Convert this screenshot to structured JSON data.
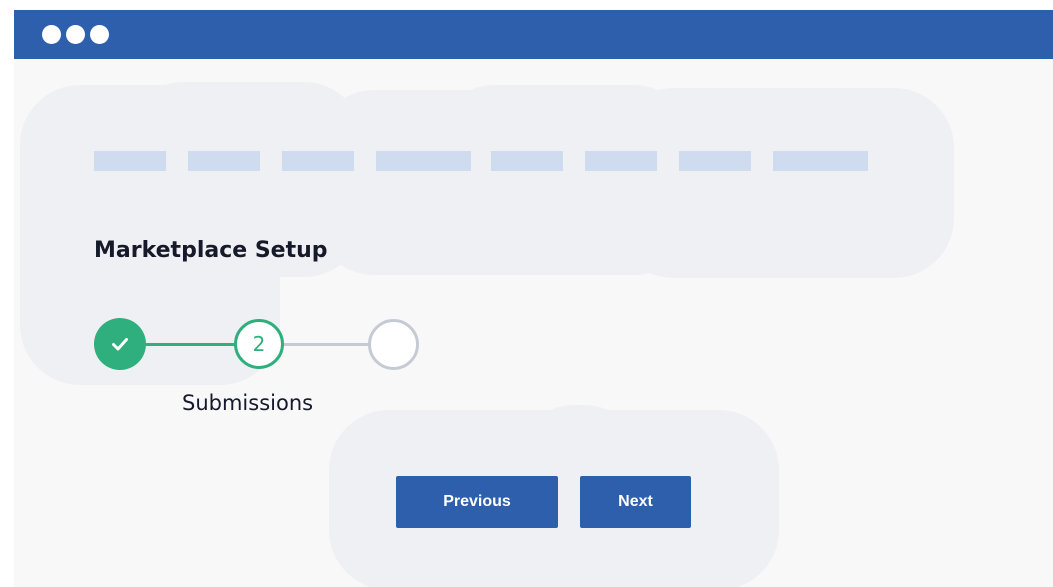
{
  "window": {
    "titlebar_color": "#2e5fad",
    "controls": [
      "window-dot",
      "window-dot",
      "window-dot"
    ]
  },
  "wizard": {
    "title": "Marketplace Setup",
    "steps": [
      {
        "status": "complete",
        "icon": "check-icon",
        "label": ""
      },
      {
        "status": "current",
        "number": "2",
        "label": "Submissions"
      },
      {
        "status": "upcoming",
        "label": ""
      }
    ],
    "colors": {
      "complete": "#2eaf7d",
      "upcoming": "#c5cad5"
    }
  },
  "actions": {
    "previous_label": "Previous",
    "next_label": "Next"
  }
}
